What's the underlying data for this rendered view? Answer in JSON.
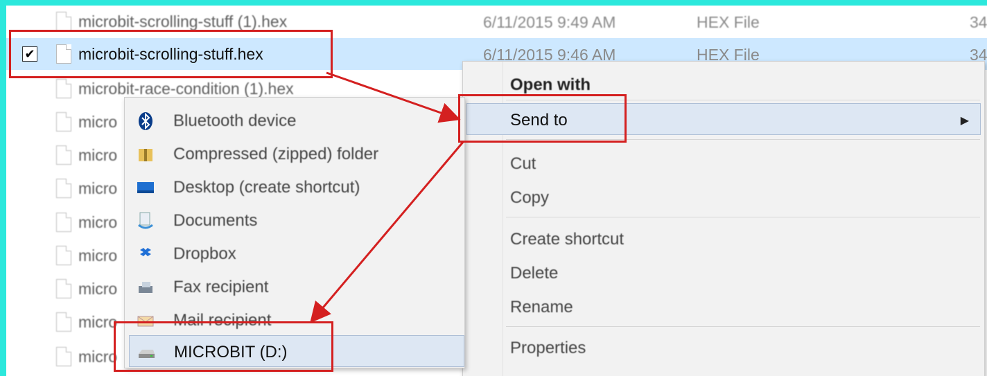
{
  "files": [
    {
      "name": "microbit-scrolling-stuff (1).hex",
      "date": "6/11/2015 9:49 AM",
      "type": "HEX File",
      "size": "34"
    },
    {
      "name": "microbit-scrolling-stuff.hex",
      "date": "6/11/2015 9:46 AM",
      "type": "HEX File",
      "size": "34",
      "selected": true,
      "checkbox": "✔"
    },
    {
      "name": "microbit-race-condition (1).hex",
      "date": "",
      "type": "",
      "size": ""
    },
    {
      "name": "micro",
      "date": "",
      "type": "",
      "size": ""
    },
    {
      "name": "micro",
      "date": "",
      "type": "",
      "size": ""
    },
    {
      "name": "micro",
      "date": "",
      "type": "",
      "size": ""
    },
    {
      "name": "micro",
      "date": "",
      "type": "",
      "size": ""
    },
    {
      "name": "micro",
      "date": "",
      "type": "",
      "size": ""
    },
    {
      "name": "micro",
      "date": "",
      "type": "",
      "size": ""
    },
    {
      "name": "micro",
      "date": "",
      "type": "",
      "size": ""
    },
    {
      "name": "micro",
      "date": "",
      "type": "",
      "size": ""
    }
  ],
  "context_menu": {
    "open_with": "Open with",
    "send_to": "Send to",
    "send_to_arrow": "▶",
    "cut": "Cut",
    "copy": "Copy",
    "create_shortcut": "Create shortcut",
    "delete": "Delete",
    "rename": "Rename",
    "properties": "Properties"
  },
  "send_to_menu": {
    "items": [
      {
        "label": "Bluetooth device",
        "icon": "bluetooth-icon"
      },
      {
        "label": "Compressed (zipped) folder",
        "icon": "zip-folder-icon"
      },
      {
        "label": "Desktop (create shortcut)",
        "icon": "desktop-icon"
      },
      {
        "label": "Documents",
        "icon": "documents-icon"
      },
      {
        "label": "Dropbox",
        "icon": "dropbox-icon"
      },
      {
        "label": "Fax recipient",
        "icon": "fax-icon"
      },
      {
        "label": "Mail recipient",
        "icon": "mail-icon"
      },
      {
        "label": "MICROBIT (D:)",
        "icon": "drive-icon",
        "highlighted": true
      }
    ]
  },
  "colors": {
    "background": "#2ce8dc",
    "selection": "#cde8ff",
    "annotation_red": "#d42020",
    "menu_highlight": "#dde7f3"
  }
}
